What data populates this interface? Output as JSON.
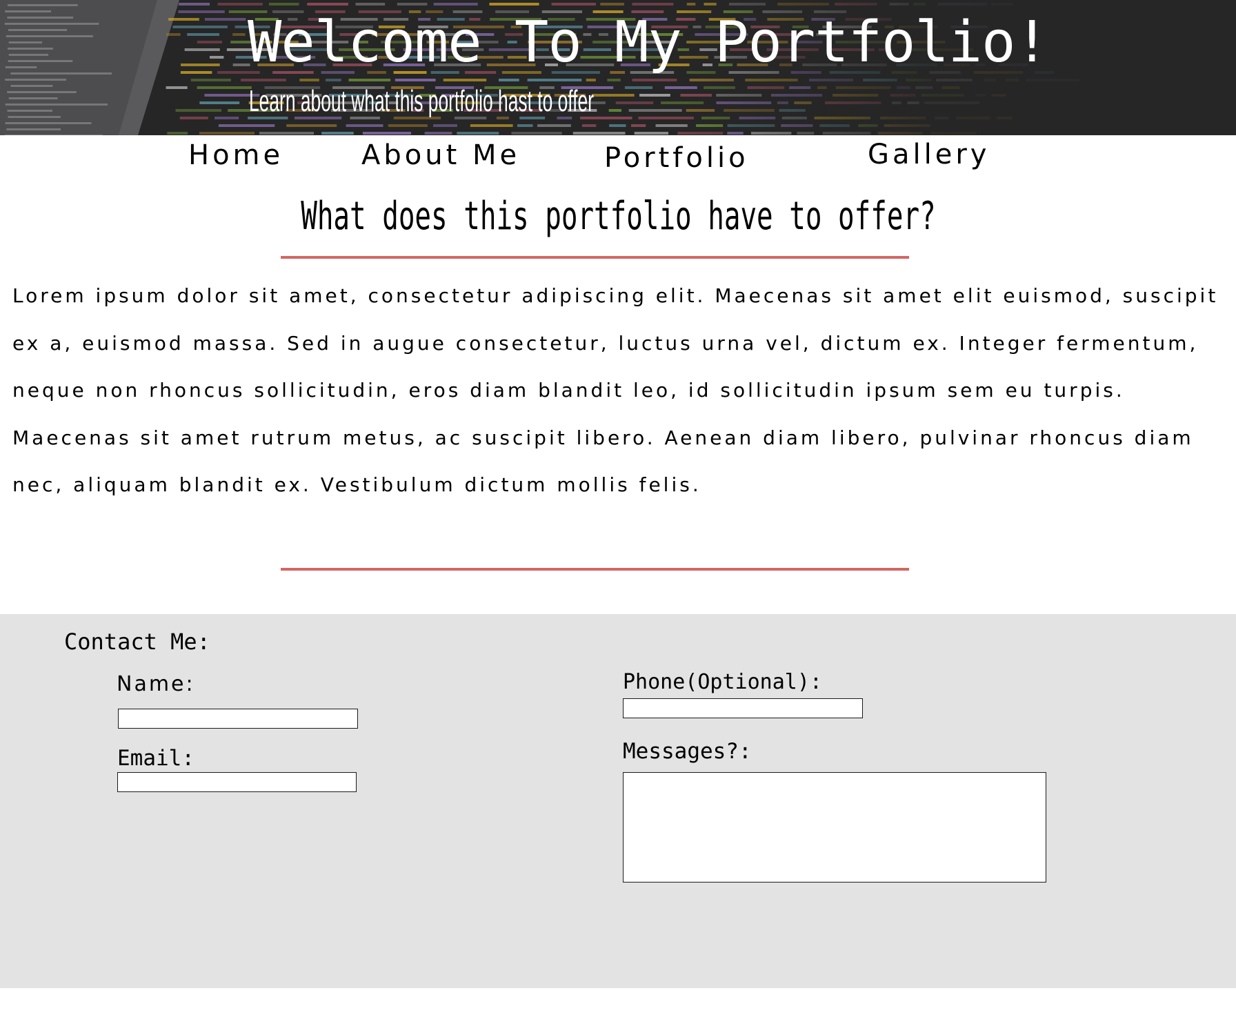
{
  "header": {
    "title": "Welcome To My Portfolio!",
    "subtitle": "Learn about what this portfolio hast to offer"
  },
  "nav": {
    "items": [
      {
        "label": "Home"
      },
      {
        "label": "About Me"
      },
      {
        "label": "Portfolio"
      },
      {
        "label": "Gallery"
      }
    ]
  },
  "main": {
    "heading": "What does this portfolio have to offer?",
    "body": "Lorem ipsum dolor sit amet, consectetur adipiscing elit. Maecenas sit amet elit euismod, suscipit ex a, euismod massa. Sed in augue consectetur, luctus urna vel, dictum ex. Integer fermentum, neque non rhoncus sollicitudin, eros diam blandit leo, id sollicitudin ipsum sem eu turpis. Maecenas sit amet rutrum metus, ac suscipit libero. Aenean diam libero, pulvinar rhoncus diam nec, aliquam blandit ex.  Vestibulum dictum mollis felis.",
    "accent_color": "#d46563"
  },
  "contact": {
    "title": "Contact Me:",
    "name_label": "Name:",
    "name_value": "",
    "email_label": "Email:",
    "email_value": "",
    "phone_label": "Phone(Optional):",
    "phone_value": "",
    "messages_label": "Messages?:",
    "messages_value": "",
    "background_color": "#e3e3e3"
  }
}
